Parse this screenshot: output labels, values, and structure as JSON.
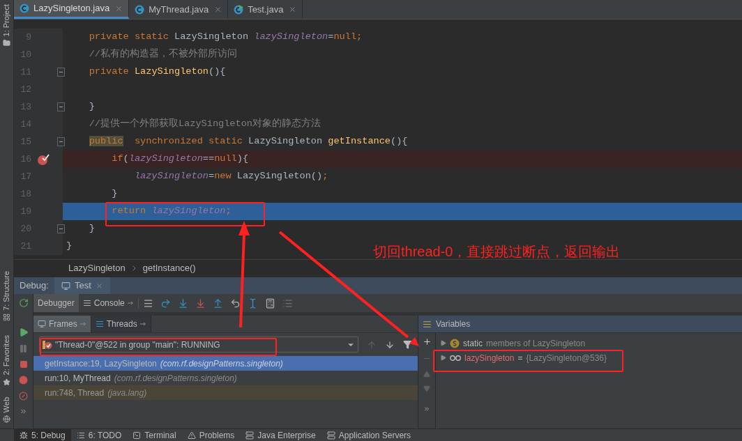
{
  "side_tool_windows": [
    "1: Project",
    "7: Structure",
    "2: Favorites",
    "Web"
  ],
  "editor_tabs": [
    {
      "label": "LazySingleton.java",
      "selected": true,
      "kind": "class"
    },
    {
      "label": "MyThread.java",
      "selected": false,
      "kind": "class"
    },
    {
      "label": "Test.java",
      "selected": false,
      "kind": "runnable"
    }
  ],
  "code_lines": [
    {
      "number": "9",
      "kind": "normal",
      "fold": false,
      "tokens": [
        {
          "kind": "keyword",
          "text": "    private static "
        },
        {
          "kind": "plain",
          "text": "LazySingleton "
        },
        {
          "kind": "field",
          "text": "lazySingleton"
        },
        {
          "kind": "plain",
          "text": "="
        },
        {
          "kind": "keyword",
          "text": "null;"
        }
      ]
    },
    {
      "number": "10",
      "kind": "normal",
      "fold": false,
      "tokens": [
        {
          "kind": "comment",
          "text": "    //私有的构造器，不被外部所访问"
        }
      ]
    },
    {
      "number": "11",
      "kind": "normal",
      "fold": true,
      "tokens": [
        {
          "kind": "keyword",
          "text": "    private "
        },
        {
          "kind": "method",
          "text": "LazySingleton"
        },
        {
          "kind": "plain",
          "text": "(){"
        }
      ]
    },
    {
      "number": "12",
      "kind": "normal",
      "fold": false
    },
    {
      "number": "13",
      "kind": "normal",
      "fold": true,
      "tokens": [
        {
          "kind": "plain",
          "text": "    }"
        }
      ]
    },
    {
      "number": "14",
      "kind": "normal",
      "fold": false,
      "tokens": [
        {
          "kind": "comment",
          "text": "    //提供一个外部获取LazySingleton对象的静态方法"
        }
      ]
    },
    {
      "number": "15",
      "kind": "normal",
      "fold": true,
      "tokens": [
        {
          "kind": "marked",
          "text": "    public"
        },
        {
          "kind": "keyword",
          "text": "  synchronized static "
        },
        {
          "kind": "plain",
          "text": "LazySingleton "
        },
        {
          "kind": "method",
          "text": "getInstance"
        },
        {
          "kind": "plain",
          "text": "(){"
        }
      ]
    },
    {
      "number": "16",
      "kind": "breakpoint",
      "fold": false,
      "tokens": [
        {
          "kind": "keyword",
          "text": "        if"
        },
        {
          "kind": "plain",
          "text": "("
        },
        {
          "kind": "field",
          "text": "lazySingleton"
        },
        {
          "kind": "plain",
          "text": "=="
        },
        {
          "kind": "keyword",
          "text": "null"
        },
        {
          "kind": "plain",
          "text": "){"
        }
      ]
    },
    {
      "number": "17",
      "kind": "normal",
      "fold": false,
      "tokens": [
        {
          "kind": "field",
          "text": "            lazySingleton"
        },
        {
          "kind": "plain",
          "text": "="
        },
        {
          "kind": "keyword",
          "text": "new "
        },
        {
          "kind": "plain",
          "text": "LazySingleton()"
        },
        {
          "kind": "keyword",
          "text": ";"
        }
      ]
    },
    {
      "number": "18",
      "kind": "normal",
      "fold": false,
      "tokens": [
        {
          "kind": "plain",
          "text": "        }"
        }
      ]
    },
    {
      "number": "19",
      "kind": "execution",
      "fold": false,
      "tokens": [
        {
          "kind": "keyword",
          "text": "        return "
        },
        {
          "kind": "field",
          "text": "lazySingleton"
        },
        {
          "kind": "keyword",
          "text": ";"
        }
      ]
    },
    {
      "number": "20",
      "kind": "normal",
      "fold": true,
      "tokens": [
        {
          "kind": "plain",
          "text": "    }"
        }
      ]
    },
    {
      "number": "21",
      "kind": "normal",
      "fold": false,
      "tokens": [
        {
          "kind": "plain",
          "text": "}"
        }
      ]
    }
  ],
  "breadcrumb": [
    "LazySingleton",
    "getInstance()"
  ],
  "debug": {
    "title": "Debug:",
    "session_tab": "Test",
    "tabs": [
      {
        "label": "Debugger",
        "selected": true
      },
      {
        "label": "Console",
        "selected": false
      }
    ],
    "frames_tabs": [
      {
        "label": "Frames",
        "selected": true
      },
      {
        "label": "Threads",
        "selected": false
      }
    ],
    "thread": "\"Thread-0\"@522 in group \"main\": RUNNING",
    "frames": [
      {
        "method": "getInstance:19, LazySingleton",
        "package": "(com.rf.designPatterns.singleton)",
        "selected": true,
        "kind": "app"
      },
      {
        "method": "run:10, MyThread",
        "package": "(com.rf.designPatterns.singleton)",
        "selected": false,
        "kind": "app"
      },
      {
        "method": "run:748, Thread",
        "package": "(java.lang)",
        "selected": false,
        "kind": "library"
      }
    ],
    "variables": {
      "title": "Variables",
      "items": [
        {
          "kind": "static",
          "name": "static",
          "value": "members of LazySingleton"
        },
        {
          "kind": "field",
          "name": "lazySingleton",
          "separator": "=",
          "value": "{LazySingleton@536}"
        }
      ]
    }
  },
  "status_bar": [
    {
      "label": "5: Debug",
      "selected": true
    },
    {
      "label": "6: TODO",
      "selected": false
    },
    {
      "label": "Terminal",
      "selected": false
    },
    {
      "label": "Problems",
      "selected": false
    },
    {
      "label": "Java Enterprise",
      "selected": false
    },
    {
      "label": "Application Servers",
      "selected": false
    }
  ],
  "annotation": {
    "text": "切回thread-0，直接跳过断点，返回输出"
  }
}
